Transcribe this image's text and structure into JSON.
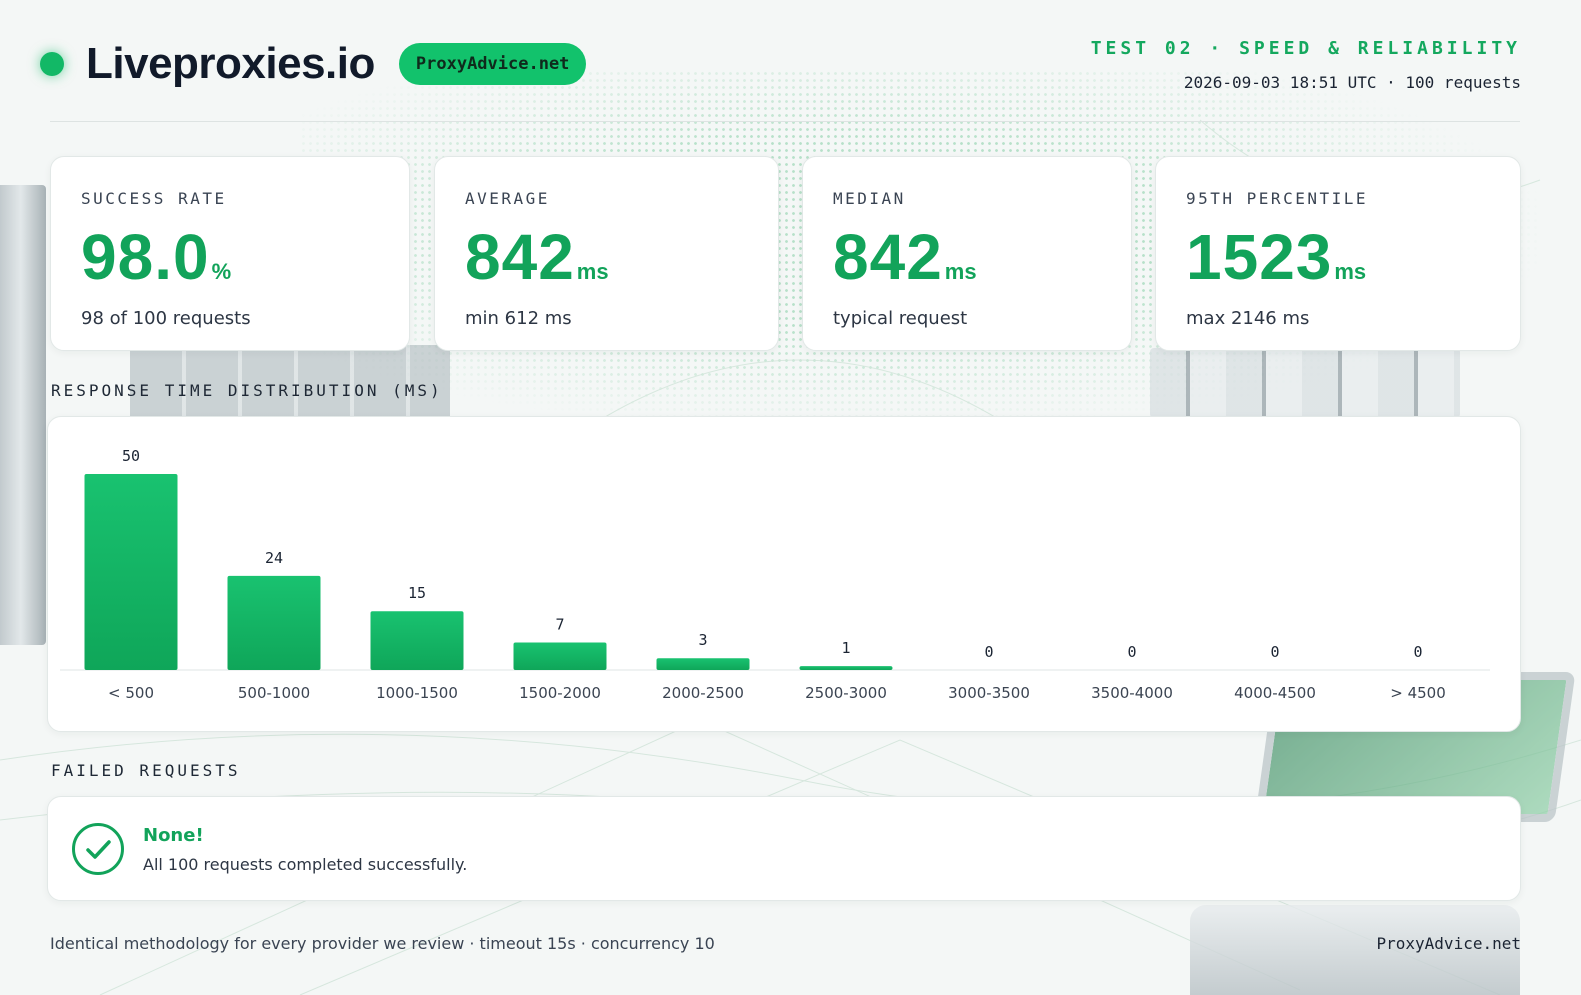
{
  "header": {
    "provider_name": "Liveproxies.io",
    "source_badge": "ProxyAdvice.net",
    "test_title": "TEST 02 · SPEED & RELIABILITY",
    "test_meta": "2026-09-03 18:51 UTC · 100 requests"
  },
  "stats": [
    {
      "label": "SUCCESS RATE",
      "value": "98.0",
      "unit": "%",
      "sub": "98 of 100 requests"
    },
    {
      "label": "AVERAGE",
      "value": "842",
      "unit": "ms",
      "sub": "min 612 ms"
    },
    {
      "label": "MEDIAN",
      "value": "842",
      "unit": "ms",
      "sub": "typical request"
    },
    {
      "label": "95TH PERCENTILE",
      "value": "1523",
      "unit": "ms",
      "sub": "max 2146 ms"
    }
  ],
  "distribution": {
    "section_label": "RESPONSE TIME DISTRIBUTION (MS)"
  },
  "chart_data": {
    "type": "bar",
    "title": "RESPONSE TIME DISTRIBUTION (MS)",
    "categories": [
      "< 500",
      "500-1000",
      "1000-1500",
      "1500-2000",
      "2000-2500",
      "2500-3000",
      "3000-3500",
      "3500-4000",
      "4000-4500",
      "> 4500"
    ],
    "values": [
      50,
      24,
      15,
      7,
      3,
      1,
      0,
      0,
      0,
      0
    ],
    "ylim": [
      0,
      50
    ],
    "grid": false,
    "colors": {
      "bar_top": "#19c270",
      "bar_bottom": "#0fa659"
    }
  },
  "failed": {
    "section_label": "FAILED REQUESTS",
    "title": "None!",
    "message": "All 100 requests completed successfully."
  },
  "footer": {
    "methodology": "Identical methodology for every provider we review · timeout 15s · concurrency 10",
    "brand": "ProxyAdvice.net"
  },
  "colors": {
    "accent": "#12a35a",
    "badge": "#12c26c",
    "status_dot": "#12b866"
  },
  "icons": {
    "status": "status-dot-icon",
    "success": "check-circle-icon"
  }
}
